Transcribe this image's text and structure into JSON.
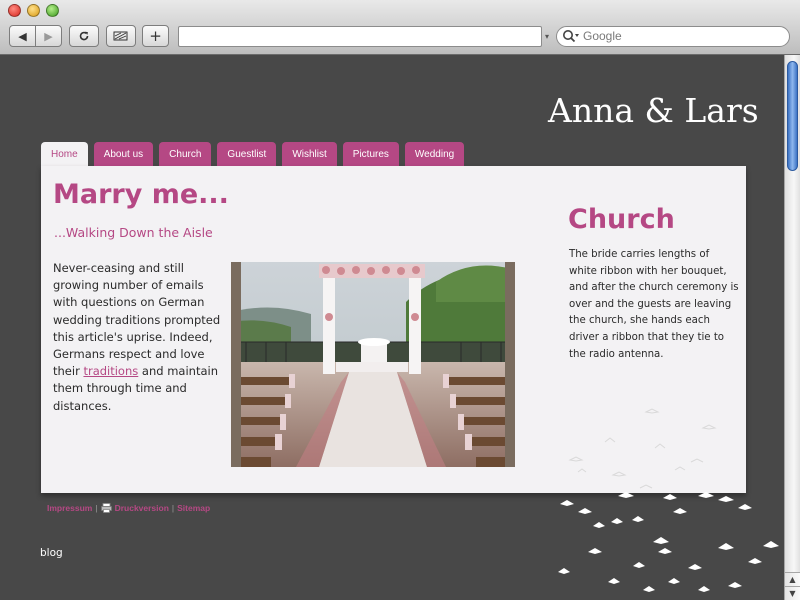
{
  "browser": {
    "search_placeholder": "Google",
    "url": "",
    "url_dropdown": "▾"
  },
  "site": {
    "title": "Anna & Lars"
  },
  "nav": {
    "tabs": [
      {
        "label": "Home",
        "active": true
      },
      {
        "label": "About us",
        "active": false
      },
      {
        "label": "Church",
        "active": false
      },
      {
        "label": "Guestlist",
        "active": false
      },
      {
        "label": "Wishlist",
        "active": false
      },
      {
        "label": "Pictures",
        "active": false
      },
      {
        "label": "Wedding",
        "active": false
      }
    ]
  },
  "main": {
    "heading": "Marry me...",
    "subheading": "...Walking Down the Aisle",
    "body_before_link": "Never-ceasing and still growing number of emails with questions on German wedding traditions prompted this article's uprise. Indeed, Germans respect and love their ",
    "body_link": "traditions",
    "body_after_link": " and maintain them through time and distances."
  },
  "sidebar": {
    "heading": "Church",
    "text": "The bride carries lengths of white ribbon with her bouquet, and after the church ceremony is over and the guests are leaving the church, she hands each driver a ribbon that they tie to the radio antenna."
  },
  "footer": {
    "impressum": "Impressum",
    "druckversion": "Druckversion",
    "sitemap": "Sitemap",
    "separator": "|",
    "blog": "blog"
  },
  "colors": {
    "accent": "#b54884",
    "page_background": "#484848",
    "panel_background": "#f3f2f4"
  }
}
